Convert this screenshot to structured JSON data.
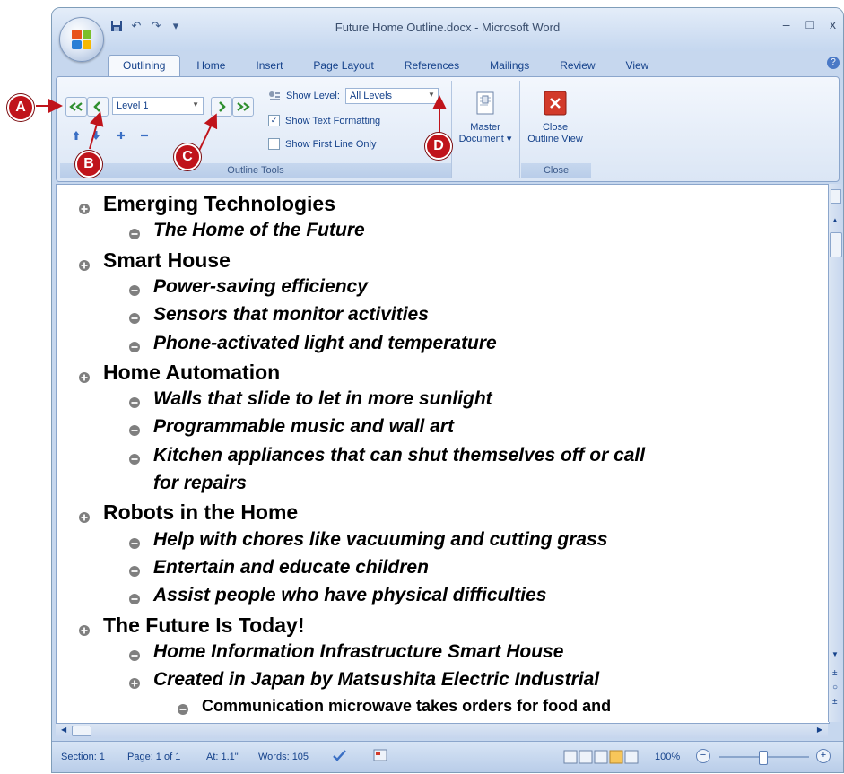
{
  "window": {
    "title": "Future Home Outline.docx - Microsoft Word",
    "minimize": "–",
    "maximize": "□",
    "close": "x"
  },
  "qat": {
    "undo_icon": "↶",
    "redo_icon": "↷",
    "more": "▾"
  },
  "tabs": [
    {
      "label": "Outlining",
      "active": true
    },
    {
      "label": "Home"
    },
    {
      "label": "Insert"
    },
    {
      "label": "Page Layout"
    },
    {
      "label": "References"
    },
    {
      "label": "Mailings"
    },
    {
      "label": "Review"
    },
    {
      "label": "View"
    }
  ],
  "help": "?",
  "outline_tools": {
    "group_label": "Outline Tools",
    "level_value": "Level 1",
    "show_level_label": "Show Level:",
    "show_level_value": "All Levels",
    "show_text_formatting": "Show Text Formatting",
    "show_text_formatting_checked": true,
    "show_first_line_only": "Show First Line Only",
    "show_first_line_only_checked": false
  },
  "master_document": {
    "line1": "Master",
    "line2": "Document ▾"
  },
  "close_group": {
    "line1": "Close",
    "line2": "Outline View",
    "group_label": "Close"
  },
  "callouts": {
    "a": "A",
    "b": "B",
    "c": "C",
    "d": "D"
  },
  "outline": [
    {
      "level": 1,
      "text": "Emerging Technologies",
      "expand": "plus"
    },
    {
      "level": 2,
      "text": "The Home of the Future",
      "expand": "minus"
    },
    {
      "level": 1,
      "text": "Smart House",
      "expand": "plus"
    },
    {
      "level": 2,
      "text": "Power-saving efficiency",
      "expand": "minus"
    },
    {
      "level": 2,
      "text": "Sensors that monitor activities",
      "expand": "minus"
    },
    {
      "level": 2,
      "text": "Phone-activated light and temperature",
      "expand": "minus"
    },
    {
      "level": 1,
      "text": "Home Automation",
      "expand": "plus"
    },
    {
      "level": 2,
      "text": "Walls that slide to let in more sunlight",
      "expand": "minus"
    },
    {
      "level": 2,
      "text": "Programmable music and wall art",
      "expand": "minus"
    },
    {
      "level": 2,
      "text": "Kitchen appliances that can shut themselves off or call",
      "expand": "minus"
    },
    {
      "level": 2,
      "text": "for repairs",
      "expand": "none"
    },
    {
      "level": 1,
      "text": "Robots in the Home",
      "expand": "plus"
    },
    {
      "level": 2,
      "text": "Help with chores like vacuuming and cutting grass",
      "expand": "minus"
    },
    {
      "level": 2,
      "text": "Entertain and educate children",
      "expand": "minus"
    },
    {
      "level": 2,
      "text": "Assist people who have physical difficulties",
      "expand": "minus"
    },
    {
      "level": 1,
      "text": "The Future Is Today!",
      "expand": "plus"
    },
    {
      "level": 2,
      "text": "Home Information Infrastructure Smart House",
      "expand": "minus"
    },
    {
      "level": 2,
      "text": "Created in Japan by Matsushita Electric Industrial",
      "expand": "plus"
    },
    {
      "level": 3,
      "text": "Communication microwave takes orders for food and",
      "expand": "minus"
    }
  ],
  "status": {
    "section": "Section: 1",
    "page": "Page: 1 of 1",
    "at": "At: 1.1\"",
    "words": "Words: 105",
    "zoom": "100%",
    "zoom_out": "−",
    "zoom_in": "+"
  },
  "colors": {
    "accent": "#15428b",
    "callout": "#c0141b",
    "ribbon": "#dbe6f5"
  }
}
